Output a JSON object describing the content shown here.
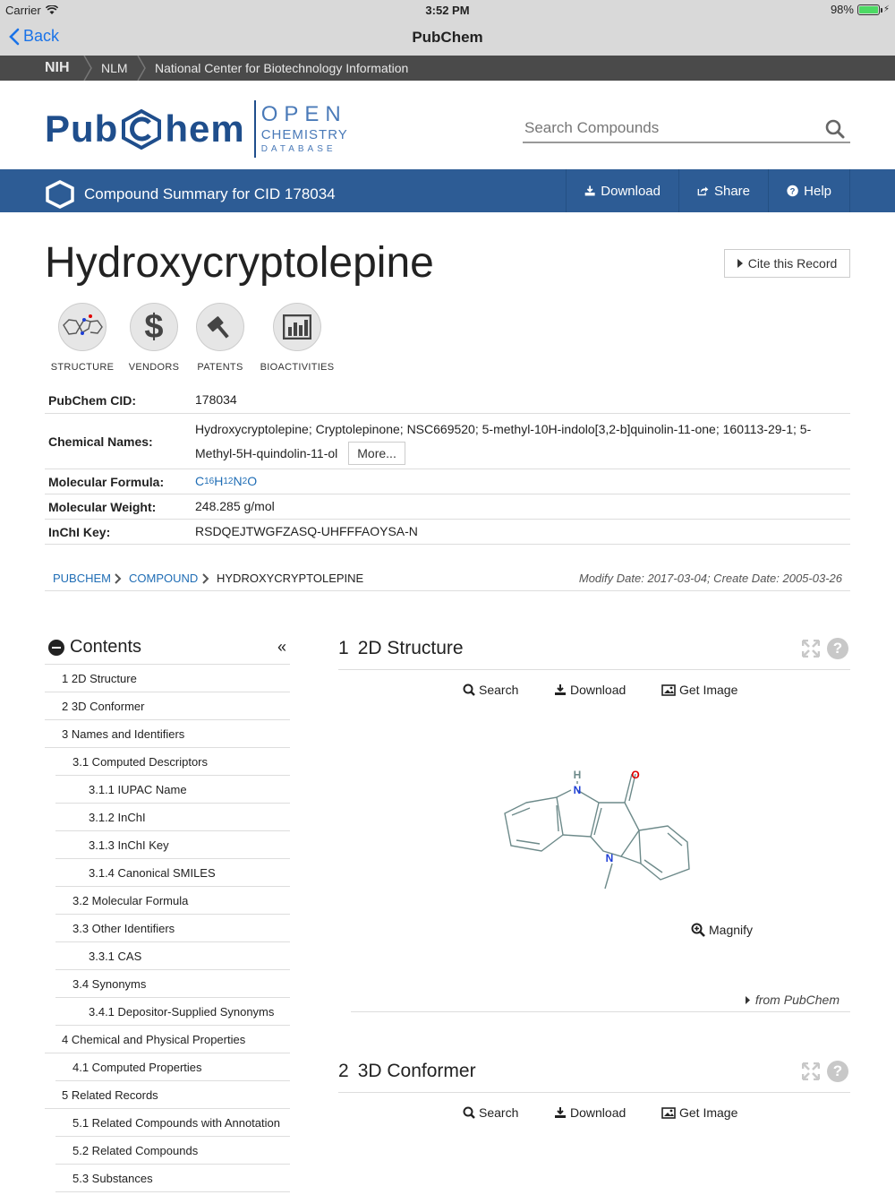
{
  "status": {
    "carrier": "Carrier",
    "time": "3:52 PM",
    "battery": "98%",
    "battery_level": 0.98
  },
  "nav": {
    "back_label": "Back",
    "title": "PubChem"
  },
  "nih_bar": {
    "nih": "NIH",
    "nlm": "NLM",
    "ncbi": "National Center for Biotechnology Information"
  },
  "logo": {
    "pub": "Pub",
    "hem": "hem",
    "open": "OPEN",
    "chemistry": "CHEMISTRY",
    "database": "DATABASE"
  },
  "search": {
    "placeholder": "Search Compounds"
  },
  "compound_bar": {
    "title": "Compound Summary for CID 178034",
    "download": "Download",
    "share": "Share",
    "help": "Help"
  },
  "compound": {
    "name": "Hydroxycryptolepine",
    "cite": "Cite this Record",
    "quick": [
      "STRUCTURE",
      "VENDORS",
      "PATENTS",
      "BIOACTIVITIES"
    ]
  },
  "info": {
    "cid_label": "PubChem CID:",
    "cid": "178034",
    "names_label": "Chemical Names:",
    "names_line1": "Hydroxycryptolepine; Cryptolepinone; NSC669520; 5-methyl-10H-indolo[3,2-b]quinolin-11-one; 160113-29-1; 5-",
    "names_line2": "Methyl-5H-quindolin-11-ol",
    "more": "More...",
    "formula_label": "Molecular Formula:",
    "formula_parts": [
      "C",
      "16",
      "H",
      "12",
      "N",
      "2",
      "O"
    ],
    "weight_label": "Molecular Weight:",
    "weight": "248.285 g/mol",
    "inchi_label": "InChI Key:",
    "inchi": "RSDQEJTWGFZASQ-UHFFFAOYSA-N"
  },
  "breadcrumb": {
    "items": [
      "PUBCHEM",
      "COMPOUND",
      "HYDROXYCRYPTOLEPINE"
    ],
    "dates": "Modify Date: 2017-03-04; Create Date: 2005-03-26"
  },
  "contents": {
    "title": "Contents",
    "items": [
      "1 2D Structure",
      "2 3D Conformer",
      "3 Names and Identifiers",
      "3.1 Computed Descriptors",
      "3.1.1 IUPAC Name",
      "3.1.2 InChI",
      "3.1.3 InChI Key",
      "3.1.4 Canonical SMILES",
      "3.2 Molecular Formula",
      "3.3 Other Identifiers",
      "3.3.1 CAS",
      "3.4 Synonyms",
      "3.4.1 Depositor-Supplied Synonyms",
      "4 Chemical and Physical Properties",
      "4.1 Computed Properties",
      "5 Related Records",
      "5.1 Related Compounds with Annotation",
      "5.2 Related Compounds",
      "5.3 Substances"
    ]
  },
  "sections": {
    "s1": {
      "num": "1",
      "title": "2D Structure",
      "search": "Search",
      "download": "Download",
      "get_image": "Get Image",
      "magnify": "Magnify",
      "from": "from PubChem"
    },
    "s2": {
      "num": "2",
      "title": "3D Conformer",
      "search": "Search",
      "download": "Download",
      "get_image": "Get Image"
    }
  },
  "structure_atoms": {
    "h": "H",
    "n1": "N",
    "o": "O",
    "n2": "N"
  },
  "colors": {
    "brand_blue": "#2d5c95",
    "link_blue": "#1f6db5",
    "nitrogen": "#1f3fd6",
    "oxygen": "#e00000"
  },
  "icons": [
    "wifi-icon",
    "back-chevron-icon",
    "search-icon",
    "download-icon",
    "share-icon",
    "help-icon",
    "caret-right-icon",
    "dollar-icon",
    "gavel-icon",
    "bar-chart-icon",
    "minus-circle-icon",
    "double-chevron-left-icon",
    "expand-icon",
    "question-icon",
    "image-icon",
    "zoom-in-icon"
  ]
}
